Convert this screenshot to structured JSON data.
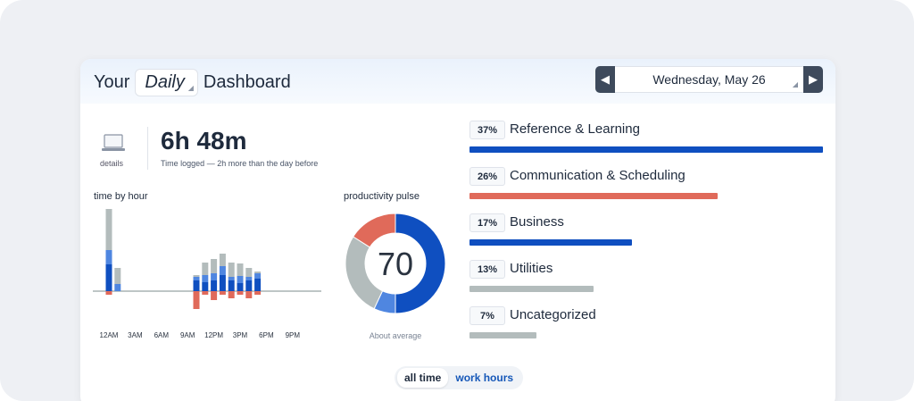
{
  "header": {
    "title_prefix": "Your",
    "period": "Daily",
    "title_suffix": "Dashboard",
    "date": "Wednesday, May 26"
  },
  "summary": {
    "details_label": "details",
    "time_logged": "6h 48m",
    "subtitle": "Time logged — 2h more than the day before"
  },
  "time_by_hour": {
    "title": "time by hour",
    "hour_labels": [
      "12AM",
      "3AM",
      "6AM",
      "9AM",
      "12PM",
      "3PM",
      "6PM",
      "9PM"
    ]
  },
  "pulse": {
    "title": "productivity pulse",
    "score": "70",
    "caption": "About average"
  },
  "categories": [
    {
      "pct": "37%",
      "name": "Reference & Learning",
      "value": 37,
      "color": "#0f4fc0"
    },
    {
      "pct": "26%",
      "name": "Communication & Scheduling",
      "value": 26,
      "color": "#e06a5a"
    },
    {
      "pct": "17%",
      "name": "Business",
      "value": 17,
      "color": "#0f4fc0"
    },
    {
      "pct": "13%",
      "name": "Utilities",
      "value": 13,
      "color": "#b3bcbc"
    },
    {
      "pct": "7%",
      "name": "Uncategorized",
      "value": 7,
      "color": "#b3bcbc"
    }
  ],
  "toggle": {
    "all_time": "all time",
    "work_hours": "work hours"
  },
  "chart_data": [
    {
      "type": "bar",
      "title": "time by hour",
      "categories": [
        "12AM",
        "1AM",
        "2AM",
        "3AM",
        "4AM",
        "5AM",
        "6AM",
        "7AM",
        "8AM",
        "9AM",
        "10AM",
        "11AM",
        "12PM",
        "1PM",
        "2PM",
        "3PM",
        "4PM",
        "5PM",
        "6PM",
        "7PM",
        "8PM",
        "9PM",
        "10PM",
        "11PM"
      ],
      "series": [
        {
          "color": "#0f4fc0",
          "values": [
            30,
            0,
            0,
            0,
            0,
            0,
            0,
            0,
            0,
            0,
            12,
            10,
            12,
            18,
            12,
            9,
            12,
            14,
            0,
            0,
            0,
            0,
            0,
            0
          ]
        },
        {
          "color": "#4f86e0",
          "values": [
            16,
            8,
            0,
            0,
            0,
            0,
            0,
            0,
            0,
            0,
            4,
            8,
            8,
            10,
            4,
            8,
            4,
            6,
            0,
            0,
            0,
            0,
            0,
            0
          ]
        },
        {
          "color": "#b3bcbc",
          "values": [
            46,
            18,
            0,
            0,
            0,
            0,
            0,
            0,
            0,
            0,
            2,
            14,
            16,
            14,
            16,
            14,
            10,
            2,
            0,
            0,
            0,
            0,
            0,
            0
          ]
        },
        {
          "color": "#e06a5a",
          "values": [
            -4,
            0,
            0,
            0,
            0,
            0,
            0,
            0,
            0,
            0,
            -20,
            -4,
            -10,
            -4,
            -8,
            -4,
            -8,
            -4,
            0,
            0,
            0,
            0,
            0,
            0
          ]
        }
      ],
      "x_tick_labels": [
        "12AM",
        "3AM",
        "6AM",
        "9AM",
        "12PM",
        "3PM",
        "6PM",
        "9PM"
      ]
    },
    {
      "type": "pie",
      "title": "productivity pulse",
      "center_value": 70,
      "slices": [
        {
          "value": 50,
          "color": "#0f4fc0"
        },
        {
          "value": 7,
          "color": "#4f86e0"
        },
        {
          "value": 27,
          "color": "#b3bcbc"
        },
        {
          "value": 16,
          "color": "#e06a5a"
        }
      ]
    }
  ]
}
